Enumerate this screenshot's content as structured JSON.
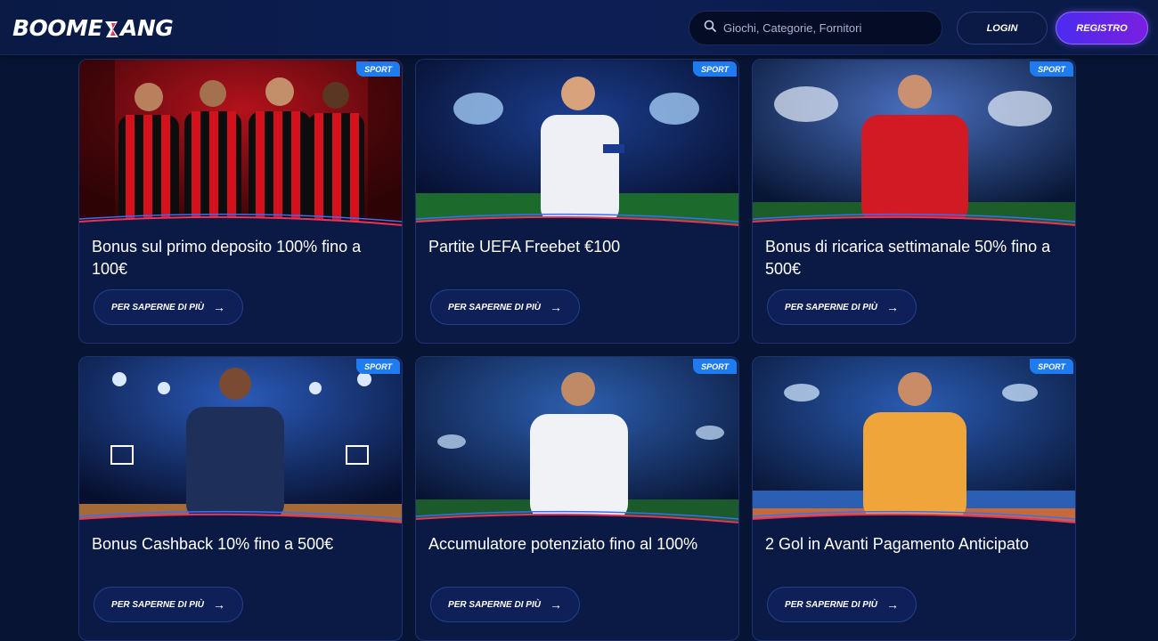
{
  "header": {
    "logo_text_left": "BOOME",
    "logo_text_right": "ANG",
    "search_placeholder": "Giochi, Categorie, Fornitori",
    "login_label": "LOGIN",
    "register_label": "REGISTRO"
  },
  "colors": {
    "background": "#071433",
    "card": "#0b1a45",
    "badge": "#1e7bf0",
    "accent_red": "#e8335a",
    "register_gradient_start": "#4b2cf0",
    "register_gradient_end": "#7a1fe0"
  },
  "promotions": [
    {
      "badge": "SPORT",
      "title": "Bonus sul primo deposito 100% fino a 100€",
      "button": "PER SAPERNE DI PIÙ",
      "image": "milan-players"
    },
    {
      "badge": "SPORT",
      "title": "Partite UEFA Freebet €100",
      "button": "PER SAPERNE DI PIÙ",
      "image": "football-player-stadium"
    },
    {
      "badge": "SPORT",
      "title": "Bonus di ricarica settimanale 50% fino a 500€",
      "button": "PER SAPERNE DI PIÙ",
      "image": "red-jersey-player"
    },
    {
      "badge": "SPORT",
      "title": "Bonus Cashback 10% fino a 500€",
      "button": "PER SAPERNE DI PIÙ",
      "image": "basketball-player"
    },
    {
      "badge": "SPORT",
      "title": "Accumulatore potenziato fino al 100%",
      "button": "PER SAPERNE DI PIÙ",
      "image": "football-celebration"
    },
    {
      "badge": "SPORT",
      "title": "2 Gol in Avanti Pagamento Anticipato",
      "button": "PER SAPERNE DI PIÙ",
      "image": "tennis-player"
    }
  ]
}
